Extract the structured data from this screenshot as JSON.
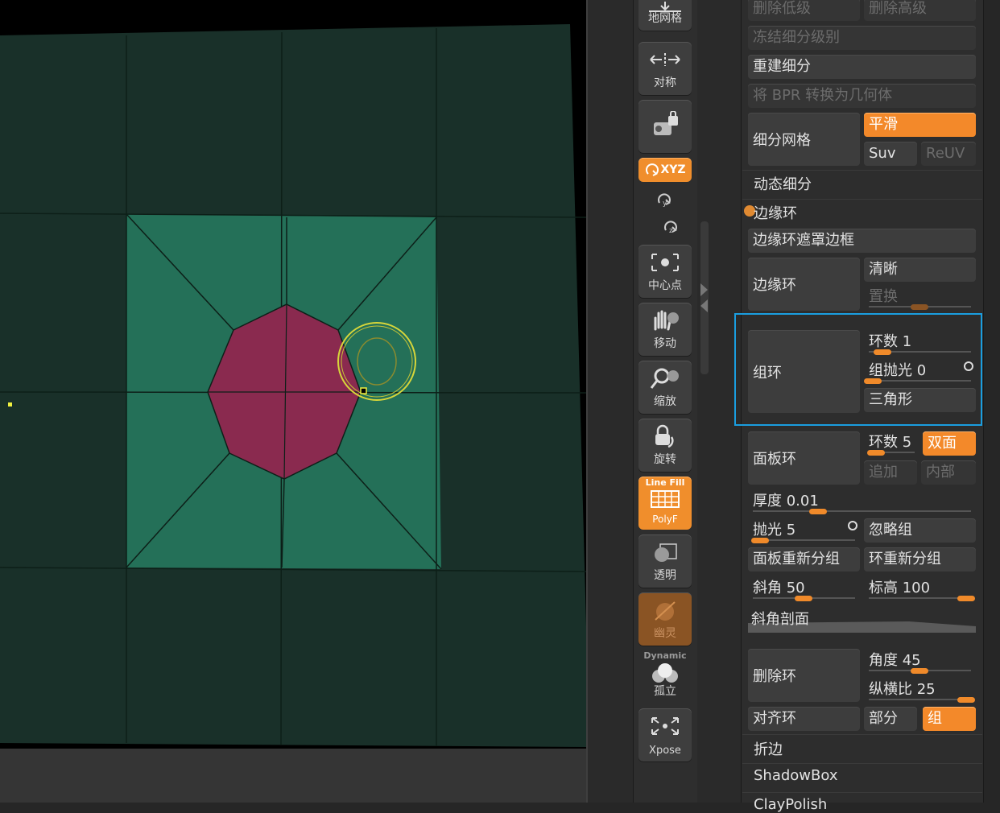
{
  "viewport": {
    "colors": {
      "background": "#000000",
      "mesh_dark": "#193029",
      "mesh_light": "#247058",
      "polygon": "#8a2a4f",
      "edges": "#0d1f18",
      "brush": "#d7d63a"
    }
  },
  "shelf": {
    "buttons": [
      {
        "name": "floor-grid-button",
        "label": "地网格",
        "icon": "floor-grid-icon",
        "style": "normal"
      },
      {
        "name": "symmetry-button",
        "label": "对称",
        "icon": "symmetry-icon",
        "style": "normal"
      },
      {
        "name": "camera-lock-button",
        "label": "",
        "icon": "camera-lock-icon",
        "style": "normal"
      },
      {
        "name": "xyz-button",
        "label": "XYZ",
        "icon": "xyz-rotate-icon",
        "style": "orange"
      },
      {
        "name": "y-rotate-button",
        "label": "",
        "icon": "y-rotate-icon",
        "style": "plain"
      },
      {
        "name": "z-rotate-button",
        "label": "",
        "icon": "z-rotate-icon",
        "style": "plain"
      },
      {
        "name": "center-point-button",
        "label": "中心点",
        "icon": "center-point-icon",
        "style": "normal"
      },
      {
        "name": "move-button",
        "label": "移动",
        "icon": "hand-icon",
        "style": "normal"
      },
      {
        "name": "scale-button",
        "label": "缩放",
        "icon": "magnifier-icon",
        "style": "normal"
      },
      {
        "name": "rotate-button",
        "label": "旋转",
        "icon": "rotate-icon",
        "style": "normal"
      },
      {
        "name": "polyf-button",
        "label": "PolyF",
        "top_label": "Line Fill",
        "icon": "polyframe-icon",
        "style": "orange"
      },
      {
        "name": "transparent-button",
        "label": "透明",
        "icon": "transparency-icon",
        "style": "normal"
      },
      {
        "name": "ghost-button",
        "label": "幽灵",
        "icon": "ghost-icon",
        "style": "dimorange"
      },
      {
        "name": "solo-button",
        "label": "孤立",
        "top_label": "Dynamic",
        "icon": "solo-icon",
        "style": "normal"
      },
      {
        "name": "xpose-button",
        "label": "Xpose",
        "icon": "xpose-icon",
        "style": "normal"
      }
    ]
  },
  "panel": {
    "top": {
      "delete_lower": "删除低级",
      "delete_higher": "删除高级",
      "freeze_subdiv": "冻结细分级别",
      "reconstruct_subdiv": "重建细分",
      "bpr_to_geo": "将 BPR 转换为几何体",
      "divide": "细分网格",
      "smooth": "平滑",
      "suv": "Suv",
      "reuv": "ReUV",
      "dynamic_subdiv": "动态细分"
    },
    "edgeloop": {
      "header": "边缘环",
      "masked_border": "边缘环遮罩边框",
      "edge_loop": "边缘环",
      "crisp": "清晰",
      "displace": "置换",
      "group_loops": "组环",
      "loops_label": "环数 1",
      "loops_value": 1,
      "gpolish_label": "组抛光 0",
      "gpolish_value": 0,
      "triangles": "三角形",
      "panel_loops": "面板环",
      "panel_loops_count_label": "环数 5",
      "panel_loops_count": 5,
      "double": "双面",
      "append": "追加",
      "inner": "内部",
      "thickness_label": "厚度 0.01",
      "thickness": 0.01,
      "polish_label": "抛光 5",
      "polish": 5,
      "ignore_groups": "忽略组",
      "panel_regroup": "面板重新分组",
      "loop_regroup": "环重新分组",
      "bevel_label": "斜角 50",
      "bevel": 50,
      "elevation_label": "标高 100",
      "elevation": 100,
      "bevel_profile": "斜角剖面",
      "delete_loops": "删除环",
      "angle_label": "角度 45",
      "angle": 45,
      "aspect_label": "纵横比 25",
      "aspect": 25,
      "align_loop": "对齐环",
      "partial": "部分",
      "groups": "组"
    },
    "crease": "折边",
    "shadowbox": "ShadowBox",
    "clay_polish": "ClayPolish"
  },
  "highlight_color": "#1a9ee0"
}
